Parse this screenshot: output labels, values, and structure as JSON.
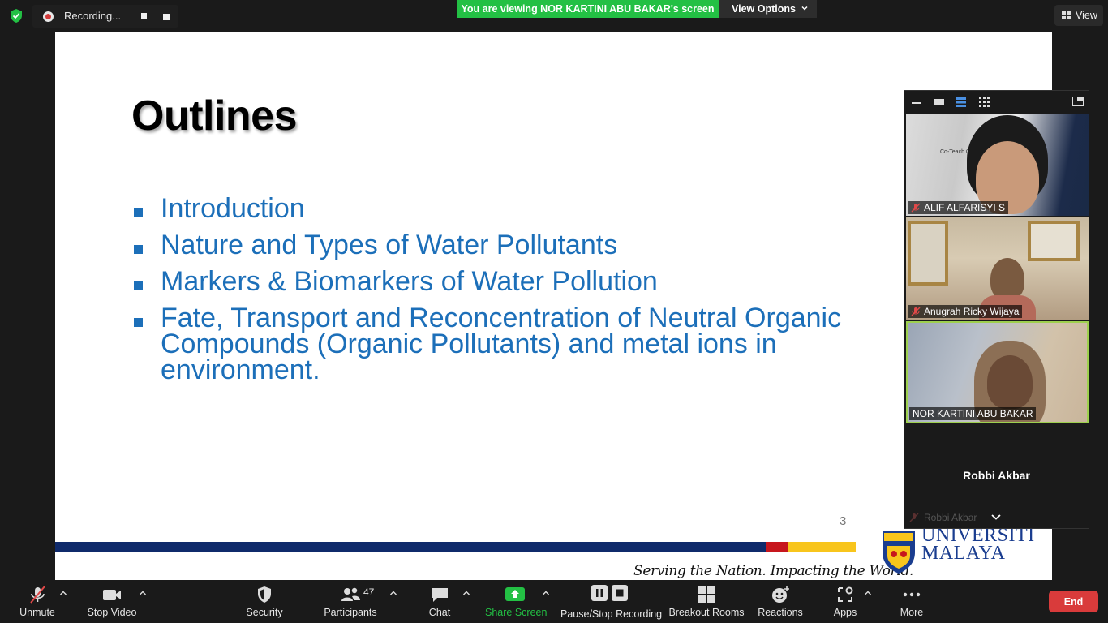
{
  "top_bar": {
    "recording_label": "Recording...",
    "viewing_banner": "You are viewing NOR KARTINI ABU BAKAR's screen",
    "view_options_label": "View Options",
    "view_label": "View"
  },
  "slide": {
    "title": "Outlines",
    "bullets": [
      "Introduction",
      "Nature and Types of Water Pollutants",
      "Markers & Biomarkers of Water Pollution",
      "Fate, Transport and Reconcentration of Neutral Organic Compounds (Organic Pollutants) and metal ions in environment."
    ],
    "page_number": "3",
    "tagline": "Serving the Nation. Impacting the World.",
    "university_line1": "UNIVERSITI",
    "university_line2": "MALAYA"
  },
  "participants_panel": {
    "tiles": [
      {
        "name": "ALIF ALFARISYI S",
        "muted": true
      },
      {
        "name": "Anugrah Ricky Wijaya",
        "muted": true
      },
      {
        "name": "NOR KARTINI ABU BAKAR",
        "muted": false
      }
    ],
    "tile1_background_text": "Co-Teach Curriculum",
    "featured_name": "Robbi Akbar",
    "featured_sub_name": "Robbi Akbar"
  },
  "toolbar": {
    "unmute": "Unmute",
    "stop_video": "Stop Video",
    "security": "Security",
    "participants": "Participants",
    "participants_count": "47",
    "chat": "Chat",
    "share_screen": "Share Screen",
    "pause_stop_recording": "Pause/Stop Recording",
    "breakout_rooms": "Breakout Rooms",
    "reactions": "Reactions",
    "apps": "Apps",
    "more": "More",
    "end": "End"
  },
  "colors": {
    "share_green": "#23c044",
    "slide_blue": "#1c6fb9",
    "end_red": "#d93b3b",
    "active_speaker_border": "#9ed04e"
  }
}
